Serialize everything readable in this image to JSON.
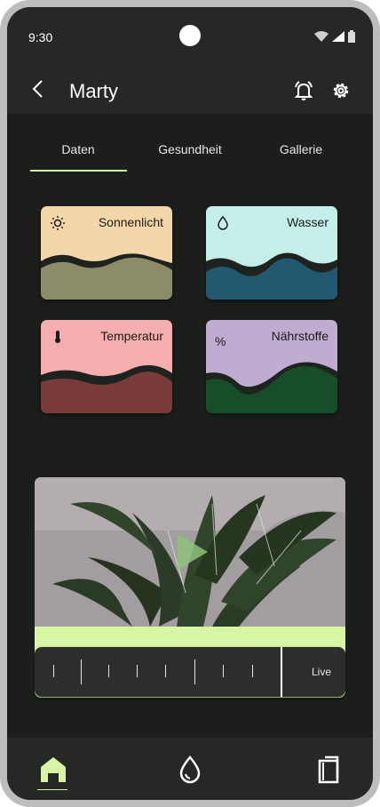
{
  "status_bar": {
    "time": "9:30"
  },
  "app_bar": {
    "title": "Marty"
  },
  "tabs": [
    {
      "label": "Daten",
      "selected": true
    },
    {
      "label": "Gesundheit",
      "selected": false
    },
    {
      "label": "Gallerie",
      "selected": false
    }
  ],
  "cards": {
    "sun": {
      "label": "Sonnenlicht",
      "icon": "sun-icon",
      "top_color": "#f3d7a8",
      "wave_color": "#8d8c68"
    },
    "water": {
      "label": "Wasser",
      "icon": "water-drop-icon",
      "top_color": "#c4efe9",
      "wave_color": "#225870"
    },
    "temp": {
      "label": "Temperatur",
      "icon": "thermometer-icon",
      "top_color": "#f5aeae",
      "wave_color": "#7a3a3a"
    },
    "nutrients": {
      "label": "Nährstoffe",
      "icon_text": "%",
      "top_color": "#c0abd1",
      "wave_color": "#184d2a"
    }
  },
  "camera": {
    "live_label": "Live"
  },
  "bottom_nav": [
    {
      "name": "home-icon",
      "selected": true
    },
    {
      "name": "water-drop-icon",
      "selected": false
    },
    {
      "name": "book-icon",
      "selected": false
    }
  ],
  "colors": {
    "accent": "#d8f5a6",
    "background": "#1b1e1b",
    "surface": "#252824"
  }
}
